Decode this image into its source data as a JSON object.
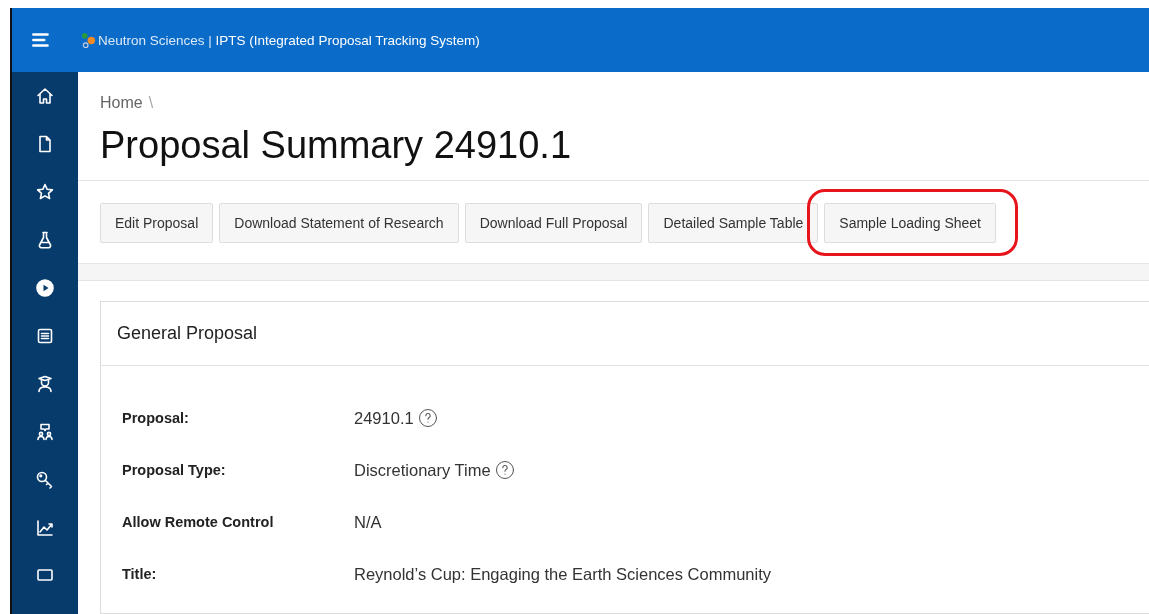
{
  "header": {
    "app_title_prefix": "Neutron Sciences",
    "separator": "|",
    "app_title": "IPTS (Integrated Proposal Tracking System)"
  },
  "breadcrumb": {
    "items": [
      "Home"
    ],
    "separator": "\\"
  },
  "page_title": "Proposal Summary 24910.1",
  "toolbar": [
    {
      "label": "Edit Proposal",
      "highlighted": false
    },
    {
      "label": "Download Statement of Research",
      "highlighted": false
    },
    {
      "label": "Download Full Proposal",
      "highlighted": false
    },
    {
      "label": "Detailed Sample Table",
      "highlighted": false
    },
    {
      "label": "Sample Loading Sheet",
      "highlighted": true
    }
  ],
  "card": {
    "title": "General Proposal",
    "fields": [
      {
        "label": "Proposal:",
        "value": "24910.1",
        "help": true
      },
      {
        "label": "Proposal Type:",
        "value": "Discretionary Time",
        "help": true
      },
      {
        "label": "Allow Remote Control",
        "value": "N/A",
        "help": false
      },
      {
        "label": "Title:",
        "value": "Reynold’s Cup: Engaging the Earth Sciences Community",
        "help": false
      }
    ]
  }
}
